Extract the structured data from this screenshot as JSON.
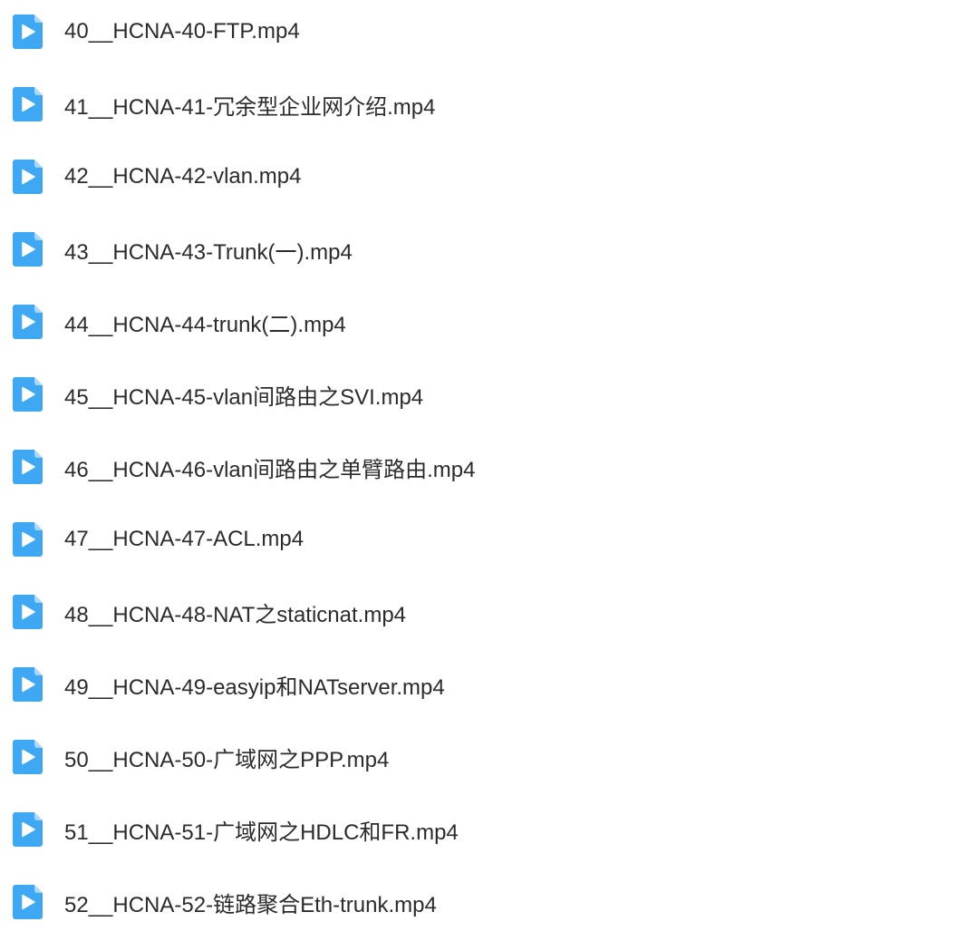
{
  "files": [
    {
      "name": "40__HCNA-40-FTP.mp4",
      "icon": "video-file-icon"
    },
    {
      "name": "41__HCNA-41-冗余型企业网介绍.mp4",
      "icon": "video-file-icon"
    },
    {
      "name": "42__HCNA-42-vlan.mp4",
      "icon": "video-file-icon"
    },
    {
      "name": "43__HCNA-43-Trunk(一).mp4",
      "icon": "video-file-icon"
    },
    {
      "name": "44__HCNA-44-trunk(二).mp4",
      "icon": "video-file-icon"
    },
    {
      "name": "45__HCNA-45-vlan间路由之SVI.mp4",
      "icon": "video-file-icon"
    },
    {
      "name": "46__HCNA-46-vlan间路由之单臂路由.mp4",
      "icon": "video-file-icon"
    },
    {
      "name": "47__HCNA-47-ACL.mp4",
      "icon": "video-file-icon"
    },
    {
      "name": "48__HCNA-48-NAT之staticnat.mp4",
      "icon": "video-file-icon"
    },
    {
      "name": "49__HCNA-49-easyip和NATserver.mp4",
      "icon": "video-file-icon"
    },
    {
      "name": "50__HCNA-50-广域网之PPP.mp4",
      "icon": "video-file-icon"
    },
    {
      "name": "51__HCNA-51-广域网之HDLC和FR.mp4",
      "icon": "video-file-icon"
    },
    {
      "name": "52__HCNA-52-链路聚合Eth-trunk.mp4",
      "icon": "video-file-icon"
    }
  ],
  "colors": {
    "icon_body": "#3fa8f4",
    "icon_fold": "#a9d8fb",
    "icon_play": "#ffffff",
    "text": "#2b2b2b"
  }
}
